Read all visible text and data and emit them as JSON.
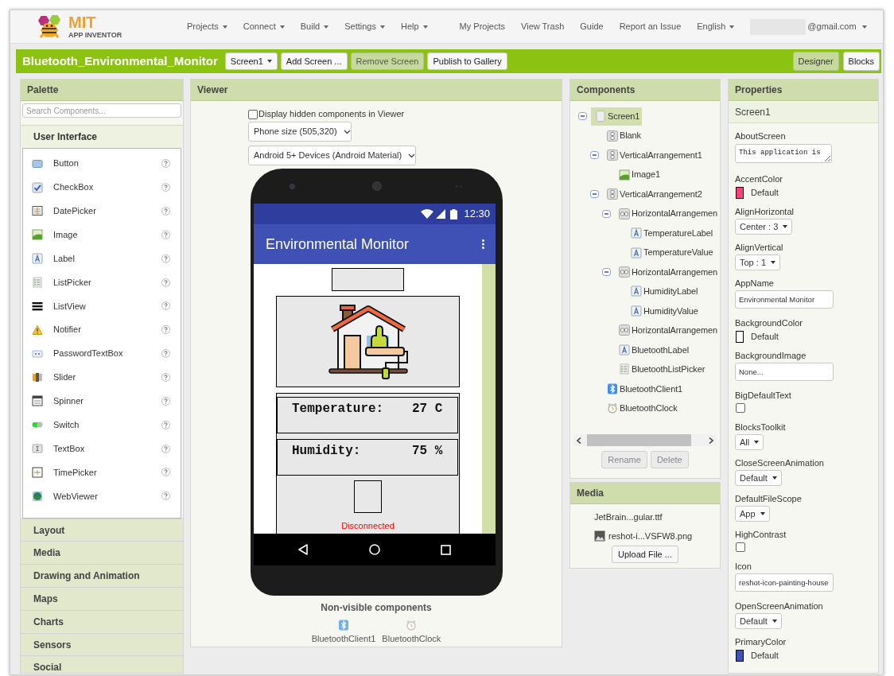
{
  "header": {
    "logo": {
      "title": "MIT",
      "subtitle": "APP INVENTOR"
    },
    "menus": [
      {
        "label": "Projects",
        "dropdown": true
      },
      {
        "label": "Connect",
        "dropdown": true
      },
      {
        "label": "Build",
        "dropdown": true
      },
      {
        "label": "Settings",
        "dropdown": true
      },
      {
        "label": "Help",
        "dropdown": true
      }
    ],
    "links": [
      {
        "label": "My Projects",
        "dropdown": false
      },
      {
        "label": "View Trash",
        "dropdown": false
      },
      {
        "label": "Guide",
        "dropdown": false
      },
      {
        "label": "Report an Issue",
        "dropdown": false
      },
      {
        "label": "English",
        "dropdown": true
      }
    ],
    "account": {
      "label": "@gmail.com",
      "dropdown": true
    }
  },
  "project_bar": {
    "title": "Bluetooth_Environmental_Monitor",
    "buttons": [
      {
        "label": "Screen1",
        "dropdown": true,
        "disabled": false
      },
      {
        "label": "Add Screen ...",
        "dropdown": false,
        "disabled": false
      },
      {
        "label": "Remove Screen",
        "dropdown": false,
        "disabled": true
      },
      {
        "label": "Publish to Gallery",
        "dropdown": false,
        "disabled": false
      }
    ],
    "views": [
      {
        "label": "Designer",
        "selected": true
      },
      {
        "label": "Blocks",
        "selected": false
      }
    ]
  },
  "palette": {
    "title": "Palette",
    "search": {
      "placeholder": "Search Components..."
    },
    "categories": [
      {
        "label": "User Interface",
        "expanded": true,
        "items": [
          {
            "label": "Button",
            "kind": "button"
          },
          {
            "label": "CheckBox",
            "kind": "checkbox"
          },
          {
            "label": "DatePicker",
            "kind": "datepicker"
          },
          {
            "label": "Image",
            "kind": "image"
          },
          {
            "label": "Label",
            "kind": "label"
          },
          {
            "label": "ListPicker",
            "kind": "listpicker"
          },
          {
            "label": "ListView",
            "kind": "listview"
          },
          {
            "label": "Notifier",
            "kind": "notifier"
          },
          {
            "label": "PasswordTextBox",
            "kind": "password"
          },
          {
            "label": "Slider",
            "kind": "slider"
          },
          {
            "label": "Spinner",
            "kind": "spinner"
          },
          {
            "label": "Switch",
            "kind": "switch"
          },
          {
            "label": "TextBox",
            "kind": "textbox"
          },
          {
            "label": "TimePicker",
            "kind": "timepicker"
          },
          {
            "label": "WebViewer",
            "kind": "webviewer"
          }
        ]
      },
      {
        "label": "Layout",
        "expanded": false
      },
      {
        "label": "Media",
        "expanded": false
      },
      {
        "label": "Drawing and Animation",
        "expanded": false
      },
      {
        "label": "Maps",
        "expanded": false
      },
      {
        "label": "Charts",
        "expanded": false
      },
      {
        "label": "Sensors",
        "expanded": false
      },
      {
        "label": "Social",
        "expanded": false
      }
    ]
  },
  "viewer": {
    "title": "Viewer",
    "show_hidden": {
      "label": "Display hidden components in Viewer",
      "checked": false
    },
    "size_select": "Phone size (505,320)",
    "theme_select": "Android 5+ Devices (Android Material)",
    "phone": {
      "time": "12:30",
      "app_title": "Environmental Monitor",
      "readings": [
        {
          "label": "Temperature:",
          "value": "27 C"
        },
        {
          "label": "Humidity:",
          "value": "75 %"
        }
      ],
      "status": "Disconnected"
    },
    "non_visible": {
      "title": "Non-visible components",
      "items": [
        {
          "label": "BluetoothClient1",
          "kind": "bluetooth"
        },
        {
          "label": "BluetoothClock",
          "kind": "clock"
        }
      ]
    }
  },
  "components": {
    "title": "Components",
    "tree": [
      {
        "label": "Screen1",
        "kind": "screen",
        "selected": true,
        "expanded": true,
        "children": [
          {
            "label": "Blank",
            "kind": "vertical",
            "selected": false
          },
          {
            "label": "VerticalArrangement1",
            "kind": "vertical",
            "selected": false,
            "expanded": true,
            "children": [
              {
                "label": "Image1",
                "kind": "image",
                "selected": false
              }
            ]
          },
          {
            "label": "VerticalArrangement2",
            "kind": "vertical",
            "selected": false,
            "expanded": true,
            "children": [
              {
                "label": "HorizontalArrangemen",
                "kind": "horizontal",
                "selected": false,
                "expanded": true,
                "children": [
                  {
                    "label": "TemperatureLabel",
                    "kind": "label",
                    "selected": false
                  },
                  {
                    "label": "TemperatureValue",
                    "kind": "label",
                    "selected": false
                  }
                ]
              },
              {
                "label": "HorizontalArrangemen",
                "kind": "horizontal",
                "selected": false,
                "expanded": true,
                "children": [
                  {
                    "label": "HumidityLabel",
                    "kind": "label",
                    "selected": false
                  },
                  {
                    "label": "HumidityValue",
                    "kind": "label",
                    "selected": false
                  }
                ]
              },
              {
                "label": "HorizontalArrangemen",
                "kind": "horizontal",
                "selected": false
              },
              {
                "label": "BluetoothLabel",
                "kind": "label",
                "selected": false
              },
              {
                "label": "BluetoothListPicker",
                "kind": "listpicker",
                "selected": false
              }
            ]
          },
          {
            "label": "BluetoothClient1",
            "kind": "bluetooth",
            "selected": false
          },
          {
            "label": "BluetoothClock",
            "kind": "clock",
            "selected": false
          }
        ]
      }
    ],
    "buttons": [
      {
        "label": "Rename",
        "disabled": true
      },
      {
        "label": "Delete",
        "disabled": true
      }
    ]
  },
  "media": {
    "title": "Media",
    "files": [
      {
        "name": "JetBrain...gular.ttf",
        "kind": "font"
      },
      {
        "name": "reshot-i...VSFW8.png",
        "kind": "image"
      }
    ],
    "upload_button": "Upload File ..."
  },
  "properties": {
    "title": "Properties",
    "component": "Screen1",
    "items": [
      {
        "name": "AboutScreen",
        "kind": "textarea",
        "value": "This application is"
      },
      {
        "name": "AccentColor",
        "kind": "color",
        "value": "Default",
        "color": "#ff4081"
      },
      {
        "name": "AlignHorizontal",
        "kind": "select",
        "value": "Center : 3"
      },
      {
        "name": "AlignVertical",
        "kind": "select",
        "value": "Top : 1"
      },
      {
        "name": "AppName",
        "kind": "text",
        "value": "Environmental Monitor"
      },
      {
        "name": "BackgroundColor",
        "kind": "color",
        "value": "Default",
        "color": "#ffffff"
      },
      {
        "name": "BackgroundImage",
        "kind": "text",
        "value": "None..."
      },
      {
        "name": "BigDefaultText",
        "kind": "checkbox",
        "checked": false
      },
      {
        "name": "BlocksToolkit",
        "kind": "select",
        "value": "All"
      },
      {
        "name": "CloseScreenAnimation",
        "kind": "select",
        "value": "Default"
      },
      {
        "name": "DefaultFileScope",
        "kind": "select",
        "value": "App"
      },
      {
        "name": "HighContrast",
        "kind": "checkbox",
        "checked": false
      },
      {
        "name": "Icon",
        "kind": "text",
        "value": "reshot-icon-painting-house"
      },
      {
        "name": "OpenScreenAnimation",
        "kind": "select",
        "value": "Default"
      },
      {
        "name": "PrimaryColor",
        "kind": "color",
        "value": "Default",
        "color": "#3f51b5"
      }
    ]
  }
}
